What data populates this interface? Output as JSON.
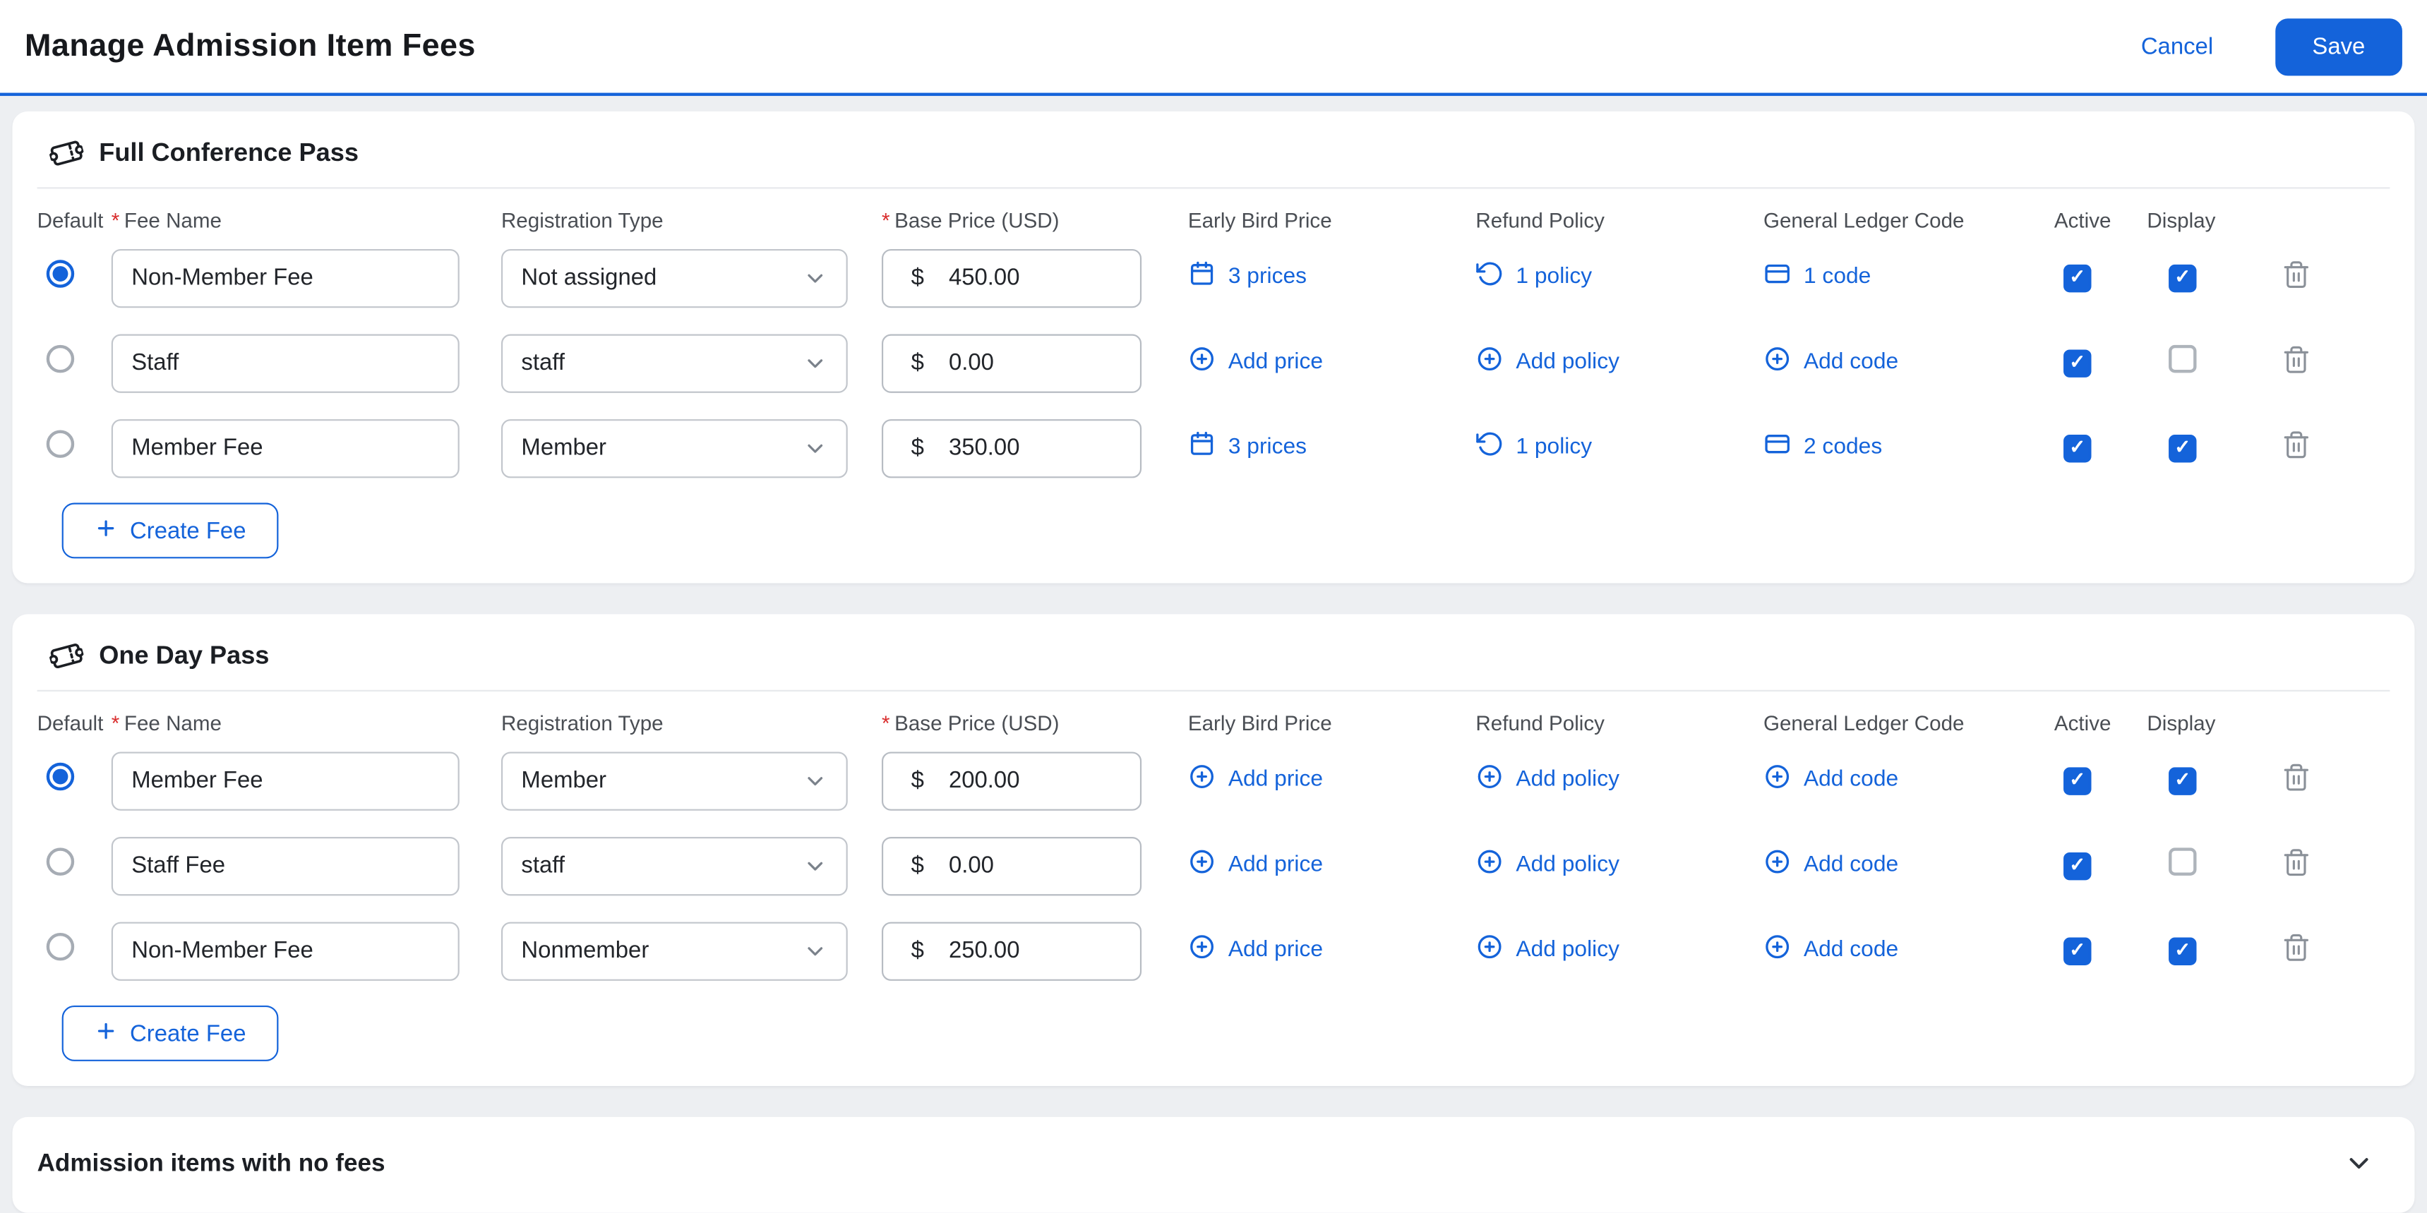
{
  "header": {
    "title": "Manage Admission Item Fees",
    "cancel_label": "Cancel",
    "save_label": "Save"
  },
  "table": {
    "required_marker": "*",
    "currency_symbol": "$",
    "columns": {
      "default": "Default",
      "fee_name": "Fee Name",
      "registration_type": "Registration Type",
      "base_price": "Base Price (USD)",
      "early_bird_price": "Early Bird Price",
      "refund_policy": "Refund Policy",
      "general_ledger_code": "General Ledger Code",
      "active": "Active",
      "display": "Display"
    },
    "create_fee_label": "Create Fee"
  },
  "icons": {
    "section": "ticket-icon",
    "existing_prices": "calendar-icon",
    "existing_policy": "refund-policy-icon",
    "existing_code": "ledger-card-icon",
    "add_action": "plus-circle-icon",
    "delete": "trash-icon",
    "dropdown": "chevron-down-icon"
  },
  "colors": {
    "accent": "#1463DA",
    "required": "#D92C2C",
    "background": "#EDEFF2"
  },
  "sections": [
    {
      "title": "Full Conference Pass",
      "fees": [
        {
          "default_selected": true,
          "name": "Non-Member Fee",
          "registration_type": "Not assigned",
          "base_price": "450.00",
          "early_bird": {
            "icon": "calendar-icon",
            "label": "3 prices"
          },
          "refund": {
            "icon": "refund-policy-icon",
            "label": "1 policy"
          },
          "ledger": {
            "icon": "ledger-card-icon",
            "label": "1 code"
          },
          "active": true,
          "display": true
        },
        {
          "default_selected": false,
          "name": "Staff",
          "registration_type": "staff",
          "base_price": "0.00",
          "early_bird": {
            "icon": "plus-circle-icon",
            "label": "Add price"
          },
          "refund": {
            "icon": "plus-circle-icon",
            "label": "Add policy"
          },
          "ledger": {
            "icon": "plus-circle-icon",
            "label": "Add code"
          },
          "active": true,
          "display": false
        },
        {
          "default_selected": false,
          "name": "Member Fee",
          "registration_type": "Member",
          "base_price": "350.00",
          "early_bird": {
            "icon": "calendar-icon",
            "label": "3 prices"
          },
          "refund": {
            "icon": "refund-policy-icon",
            "label": "1 policy"
          },
          "ledger": {
            "icon": "ledger-card-icon",
            "label": "2 codes"
          },
          "active": true,
          "display": true
        }
      ]
    },
    {
      "title": "One Day Pass",
      "fees": [
        {
          "default_selected": true,
          "name": "Member Fee",
          "registration_type": "Member",
          "base_price": "200.00",
          "early_bird": {
            "icon": "plus-circle-icon",
            "label": "Add price"
          },
          "refund": {
            "icon": "plus-circle-icon",
            "label": "Add policy"
          },
          "ledger": {
            "icon": "plus-circle-icon",
            "label": "Add code"
          },
          "active": true,
          "display": true
        },
        {
          "default_selected": false,
          "name": "Staff Fee",
          "registration_type": "staff",
          "base_price": "0.00",
          "early_bird": {
            "icon": "plus-circle-icon",
            "label": "Add price"
          },
          "refund": {
            "icon": "plus-circle-icon",
            "label": "Add policy"
          },
          "ledger": {
            "icon": "plus-circle-icon",
            "label": "Add code"
          },
          "active": true,
          "display": false
        },
        {
          "default_selected": false,
          "name": "Non-Member Fee",
          "registration_type": "Nonmember",
          "base_price": "250.00",
          "early_bird": {
            "icon": "plus-circle-icon",
            "label": "Add price"
          },
          "refund": {
            "icon": "plus-circle-icon",
            "label": "Add policy"
          },
          "ledger": {
            "icon": "plus-circle-icon",
            "label": "Add code"
          },
          "active": true,
          "display": true
        }
      ]
    }
  ],
  "footer": {
    "title": "Admission items with no fees"
  }
}
